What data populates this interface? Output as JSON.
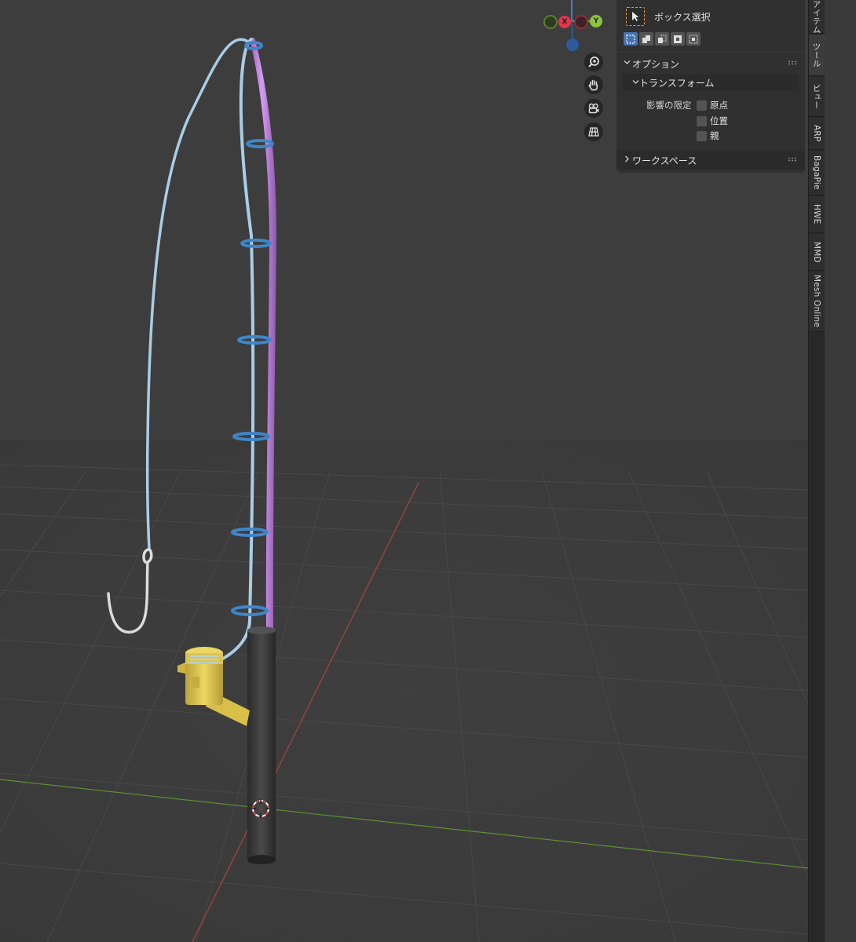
{
  "viewport": {
    "gizmo": {
      "x_label": "X",
      "y_label": "Y"
    },
    "nav_icons": [
      "zoom-icon",
      "hand-pan-icon",
      "camera-icon",
      "grid-ortho-icon"
    ]
  },
  "npanel": {
    "active_tool": {
      "label": "ボックス選択",
      "icon": "box-select-cursor-icon"
    },
    "selection_modes": [
      "set-mode-icon",
      "extend-mode-icon",
      "subtract-mode-icon",
      "invert-mode-icon",
      "intersect-mode-icon"
    ],
    "options": {
      "title": "オプション",
      "transform": {
        "title": "トランスフォーム",
        "affect_only_label": "影響の限定",
        "checkboxes": [
          {
            "label": "原点",
            "checked": false
          },
          {
            "label": "位置",
            "checked": false
          },
          {
            "label": "親",
            "checked": false
          }
        ]
      }
    },
    "workspace": {
      "title": "ワークスペース"
    }
  },
  "tabs": [
    "アイテム",
    "ツール",
    "ビュー",
    "ARP",
    "BagaPie",
    "HWE",
    "MMD",
    "Mesh Online"
  ],
  "active_tab": "ツール",
  "colors": {
    "viewport_bg": "#3d3d3d",
    "panel_bg": "#303030",
    "rod_purple": "#c58fe0",
    "line_blue": "#a9cde6",
    "ring_blue": "#3f86c8",
    "handle_dark": "#3a3a3a",
    "reel_yellow": "#e6cf57",
    "x_axis": "#c04040",
    "y_axis": "#6f9c3a",
    "active_blue": "#4772b3"
  }
}
